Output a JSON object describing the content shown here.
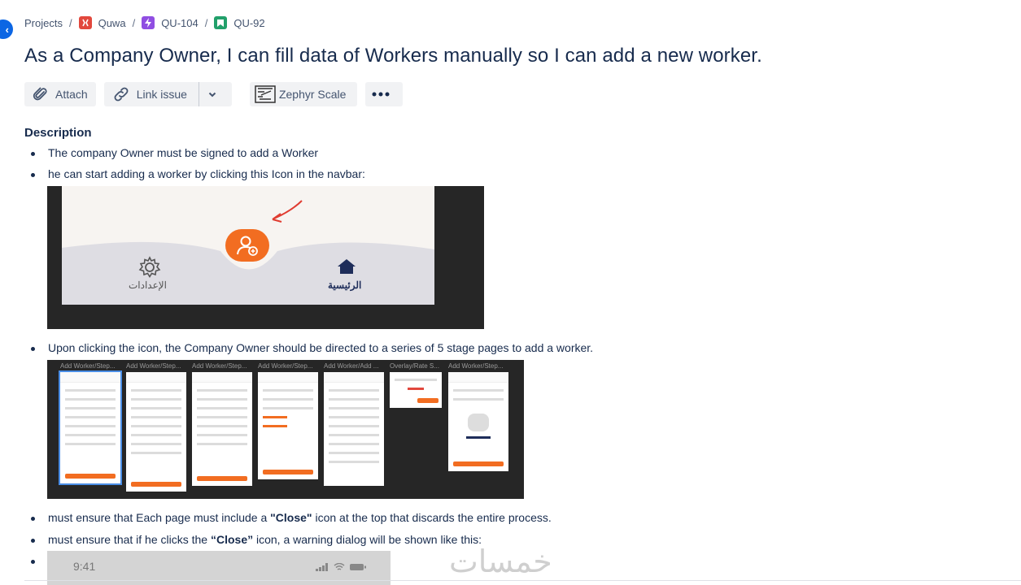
{
  "breadcrumb": {
    "projects": "Projects",
    "project": "Quwa",
    "epic": "QU-104",
    "issue": "QU-92",
    "separator": "/"
  },
  "issue": {
    "title": "As a Company Owner, I can fill data of Workers manually so I can add a new worker."
  },
  "toolbar": {
    "attach": "Attach",
    "link_issue": "Link issue",
    "zephyr": "Zephyr Scale"
  },
  "description": {
    "heading": "Description",
    "bullets": {
      "b1": "The company Owner must be signed to add a Worker",
      "b2": "he can start adding a worker by clicking this Icon in the navbar:",
      "b3": "Upon clicking the icon, the Company Owner should be directed to a series of 5 stage pages to add a worker.",
      "b4_pre": "must ensure that Each page must include a ",
      "b4_bold": "\"Close\"",
      "b4_post": " icon at the top that discards the entire process.",
      "b5_pre": "must ensure that if he clicks the ",
      "b5_bold": "“Close”",
      "b5_post": " icon, a warning dialog will be shown like this:"
    }
  },
  "navbar_image": {
    "settings_label": "الإعدادات",
    "home_label": "الرئيسية"
  },
  "stages_image": {
    "labels": [
      "Add Worker/Step...",
      "Add Worker/Step...",
      "Add Worker/Step...",
      "Add Worker/Step...",
      "Add Worker/Add ...",
      "Overlay/Rate S...",
      "Add Worker/Step..."
    ]
  },
  "phone_image": {
    "time": "9:41"
  },
  "watermark": "خمسات",
  "colors": {
    "accent": "#0c66e4",
    "orange": "#f26d21",
    "navy": "#1e2d5a"
  }
}
